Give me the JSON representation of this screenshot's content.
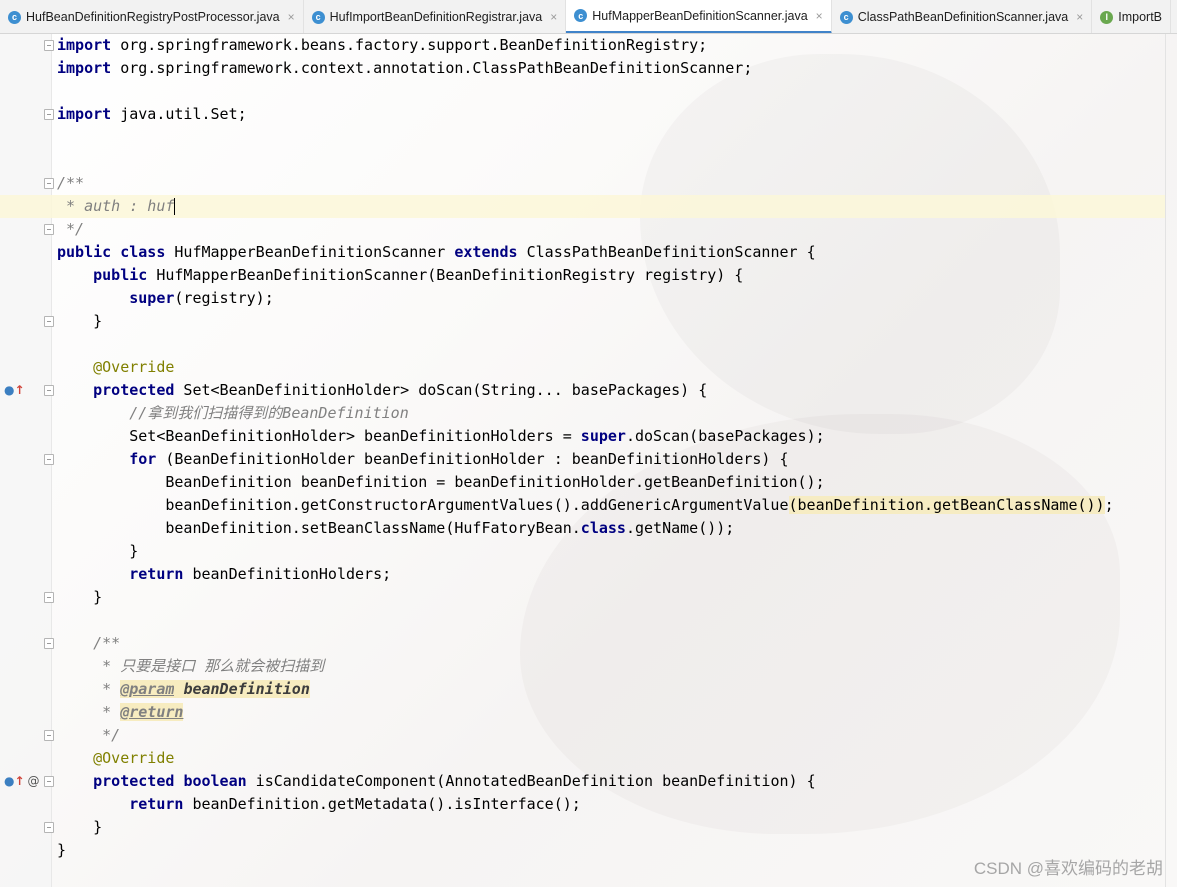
{
  "tabs": [
    {
      "label": "HufBeanDefinitionRegistryPostProcessor.java",
      "icon": "class-icon",
      "close": "×",
      "active": false
    },
    {
      "label": "HufImportBeanDefinitionRegistrar.java",
      "icon": "class-icon",
      "close": "×",
      "active": false
    },
    {
      "label": "HufMapperBeanDefinitionScanner.java",
      "icon": "class-icon",
      "close": "×",
      "active": true
    },
    {
      "label": "ClassPathBeanDefinitionScanner.java",
      "icon": "class-icon",
      "close": "×",
      "active": false
    },
    {
      "label": "ImportB",
      "icon": "interface-icon",
      "close": "",
      "active": false
    }
  ],
  "tab_icon_letters": {
    "class": "c",
    "interface": "I"
  },
  "code": {
    "import_kw": "import",
    "import1_path": " org.springframework.beans.factory.support.BeanDefinitionRegistry;",
    "import2_path": " org.springframework.context.annotation.ClassPathBeanDefinitionScanner;",
    "import3_path": " java.util.Set;",
    "doc1_open": "/**",
    "doc1_auth": " * auth : huf",
    "doc1_close": " */",
    "public_kw": "public",
    "class_kw": "class",
    "extends_kw": "extends",
    "super_kw": "super",
    "protected_kw": "protected",
    "for_kw": "for",
    "return_kw": "return",
    "boolean_kw": "boolean",
    "class_field_kw": "class",
    "class_name": " HufMapperBeanDefinitionScanner ",
    "super_class": " ClassPathBeanDefinitionScanner {",
    "ctor_sig": " HufMapperBeanDefinitionScanner(BeanDefinitionRegistry registry) {",
    "super_call": "(registry);",
    "close_brace": "}",
    "override": "@Override",
    "doscan_sig": " Set<BeanDefinitionHolder> doScan(String... basePackages) {",
    "comment_scan": "//拿到我们扫描得到的BeanDefinition",
    "holders_decl": "Set<BeanDefinitionHolder> beanDefinitionHolders = ",
    "holders_call": ".doScan(basePackages);",
    "for_loop": " (BeanDefinitionHolder beanDefinitionHolder : beanDefinitionHolders) {",
    "bd_decl": "BeanDefinition beanDefinition = beanDefinitionHolder.getBeanDefinition();",
    "bd_args_pre": "beanDefinition.getConstructorArgumentValues().addGenericArgumentValue",
    "bd_args_open": "(",
    "bd_args_hl": "beanDefinition.getBeanClassName()",
    "bd_args_close": ")",
    "bd_args_end": ";",
    "set_class_pre": "beanDefinition.setBeanClassName(HufFatoryBean.",
    "set_class_post": ".getName());",
    "return_holders": " beanDefinitionHolders;",
    "doc2_open": "/**",
    "doc2_desc": " * 只要是接口 那么就会被扫描到",
    "doc2_star": " * ",
    "doc2_param_tag": "@param",
    "doc2_param_name": "beanDefinition",
    "doc2_return_tag": "@return",
    "doc2_close": " */",
    "candidate_sig": " isCandidateComponent(AnnotatedBeanDefinition beanDefinition) {",
    "return_iface": " beanDefinition.getMetadata().isInterface();"
  },
  "gutter": {
    "override_marker": "●",
    "up_arrow": "↑",
    "at_marker": "@"
  },
  "watermark": "CSDN @喜欢编码的老胡"
}
